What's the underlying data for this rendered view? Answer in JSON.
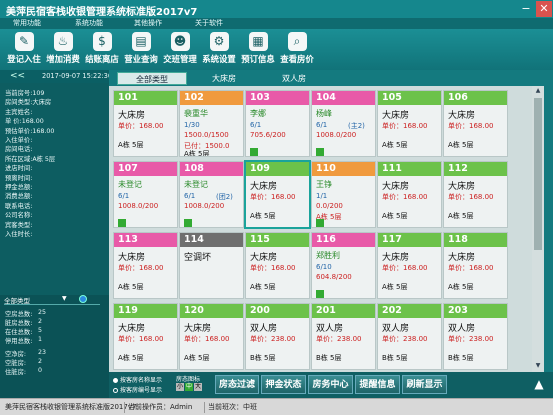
{
  "app": {
    "title": "美萍民宿客栈收银管理系统标准版2017v7",
    "minimize": "−",
    "close": "✕"
  },
  "menu": [
    "常用功能",
    "系统功能",
    "其他操作",
    "关于软件"
  ],
  "toolbar": [
    {
      "label": "登记入住",
      "icon": "pencil-icon"
    },
    {
      "label": "增加消费",
      "icon": "bottle-icon"
    },
    {
      "label": "结账离店",
      "icon": "receipt-icon"
    },
    {
      "label": "营业查询",
      "icon": "card-icon"
    },
    {
      "label": "交班管理",
      "icon": "person-icon"
    },
    {
      "label": "系统设置",
      "icon": "gear-icon"
    },
    {
      "label": "预订信息",
      "icon": "book-icon"
    },
    {
      "label": "查看房价",
      "icon": "search-icon"
    }
  ],
  "sidebar": {
    "arrow": "<<",
    "datetime": "2017-09-07 15:22:36",
    "info": [
      {
        "k": "当前房号:",
        "v": "109"
      },
      {
        "k": "房间类型:",
        "v": "大床房"
      },
      {
        "k": "主宾姓名:",
        "v": ""
      },
      {
        "k": "单  价:",
        "v": "168.00"
      },
      {
        "k": "预估单价:",
        "v": "168.00"
      },
      {
        "k": "入住单价:",
        "v": ""
      },
      {
        "k": "房间电话:",
        "v": ""
      },
      {
        "k": "所在区域:",
        "v": "A栋 5层"
      },
      {
        "k": "进店时间:",
        "v": ""
      },
      {
        "k": "预离时间:",
        "v": ""
      },
      {
        "k": "押金总额:",
        "v": ""
      },
      {
        "k": "消费总额:",
        "v": ""
      },
      {
        "k": "联系电话:",
        "v": ""
      },
      {
        "k": "公司名称:",
        "v": ""
      },
      {
        "k": "宾客类型:",
        "v": ""
      },
      {
        "k": "入住时长:",
        "v": ""
      }
    ],
    "filter": "全部类型",
    "stats1": [
      {
        "k": "空房总数:",
        "v": "25"
      },
      {
        "k": "脏房总数:",
        "v": "2"
      },
      {
        "k": "在住总数:",
        "v": "5"
      },
      {
        "k": "停用总数:",
        "v": "1"
      }
    ],
    "stats2": [
      {
        "k": "空净房:",
        "v": "23"
      },
      {
        "k": "空脏房:",
        "v": "2"
      },
      {
        "k": "住脏房:",
        "v": "0"
      }
    ]
  },
  "tabs": [
    "全部类型",
    "大床房",
    "双人房"
  ],
  "rooms": [
    {
      "no": "101",
      "c": "#6cc24a",
      "l1": "大床房",
      "l2": "单价：168.00",
      "l3": "A栋 5层"
    },
    {
      "no": "102",
      "c": "#f09a3e",
      "l1": "裴重华",
      "l2": "1/30",
      "l3": "1500.0/1500",
      "l4": "已付：1500.0",
      "l5": "A栋 5层"
    },
    {
      "no": "103",
      "c": "#e85aa8",
      "mk": "团",
      "l1": "李娜",
      "l2": "6/1",
      "l3": "705.6/200",
      "l4": ""
    },
    {
      "no": "104",
      "c": "#e85aa8",
      "mk": "团",
      "l1": "杨峰",
      "l2": "6/1",
      "l2b": "(主2)",
      "l3": "1008.0/200",
      "l4": ""
    },
    {
      "no": "105",
      "c": "#6cc24a",
      "l1": "大床房",
      "l2": "单价：168.00",
      "l3": "A栋 5层"
    },
    {
      "no": "106",
      "c": "#6cc24a",
      "l1": "大床房",
      "l2": "单价：168.00",
      "l3": "A栋 5层"
    },
    {
      "no": "107",
      "c": "#e85aa8",
      "mk": "团",
      "l1": "未登记",
      "l2": "6/1",
      "l3": "1008.0/200",
      "l4": ""
    },
    {
      "no": "108",
      "c": "#e85aa8",
      "mk": "团",
      "l1": "未登记",
      "l2": "6/1",
      "l2b": "(团2)",
      "l3": "1008.0/200",
      "l4": ""
    },
    {
      "no": "109",
      "c": "#6cc24a",
      "l1": "大床房",
      "l2": "单价：168.00",
      "l3": "A栋 5层"
    },
    {
      "no": "110",
      "c": "#f09a3e",
      "mk": "团",
      "l1": "王铮",
      "l2": "1/1",
      "l3": "0.0/200",
      "l4": "A栋 5层"
    },
    {
      "no": "111",
      "c": "#6cc24a",
      "l1": "大床房",
      "l2": "单价：168.00",
      "l3": "A栋 5层"
    },
    {
      "no": "112",
      "c": "#6cc24a",
      "l1": "大床房",
      "l2": "单价：168.00",
      "l3": "A栋 5层"
    },
    {
      "no": "113",
      "c": "#e85aa8",
      "l1": "大床房",
      "l2": "单价：168.00",
      "l3": "A栋 5层"
    },
    {
      "no": "114",
      "c": "#6f6f6f",
      "l1": "空调坏",
      "l2": "",
      "l3": ""
    },
    {
      "no": "115",
      "c": "#6cc24a",
      "l1": "大床房",
      "l2": "单价：168.00",
      "l3": "A栋 5层"
    },
    {
      "no": "116",
      "c": "#e85aa8",
      "mk": "团",
      "l1": "郑胜利",
      "l2": "6/10",
      "l3": "604.8/200",
      "l4": ""
    },
    {
      "no": "117",
      "c": "#6cc24a",
      "l1": "大床房",
      "l2": "单价：168.00",
      "l3": "A栋 5层"
    },
    {
      "no": "118",
      "c": "#6cc24a",
      "l1": "大床房",
      "l2": "单价：168.00",
      "l3": "A栋 5层"
    },
    {
      "no": "119",
      "c": "#6cc24a",
      "l1": "大床房",
      "l2": "单价：168.00",
      "l3": "A栋 5层"
    },
    {
      "no": "120",
      "c": "#6cc24a",
      "l1": "大床房",
      "l2": "单价：168.00",
      "l3": "A栋 5层"
    },
    {
      "no": "200",
      "c": "#6cc24a",
      "l1": "双人房",
      "l2": "单价：238.00",
      "l3": "B栋 5层"
    },
    {
      "no": "201",
      "c": "#6cc24a",
      "l1": "双人房",
      "l2": "单价：238.00",
      "l3": "B栋 5层"
    },
    {
      "no": "202",
      "c": "#6cc24a",
      "l1": "双人房",
      "l2": "单价：238.00",
      "l3": "B栋 5层"
    },
    {
      "no": "203",
      "c": "#6cc24a",
      "l1": "双人房",
      "l2": "单价：238.00",
      "l3": "B栋 5层"
    }
  ],
  "bottom": {
    "radio1": "按客房名称显示",
    "radio2": "按客房编号显示",
    "legend_title": "房态图标",
    "legend_small": "小",
    "legend_mid": "中",
    "legend_big": "大",
    "buttons": [
      "房态过滤",
      "押金状态",
      "房务中心",
      "提醒信息",
      "刷新显示"
    ],
    "up": "▲"
  },
  "status": [
    "美萍民宿客栈收银管理系统标准版2017v7",
    "当前操作员：Admin",
    "当前班次：中班"
  ]
}
